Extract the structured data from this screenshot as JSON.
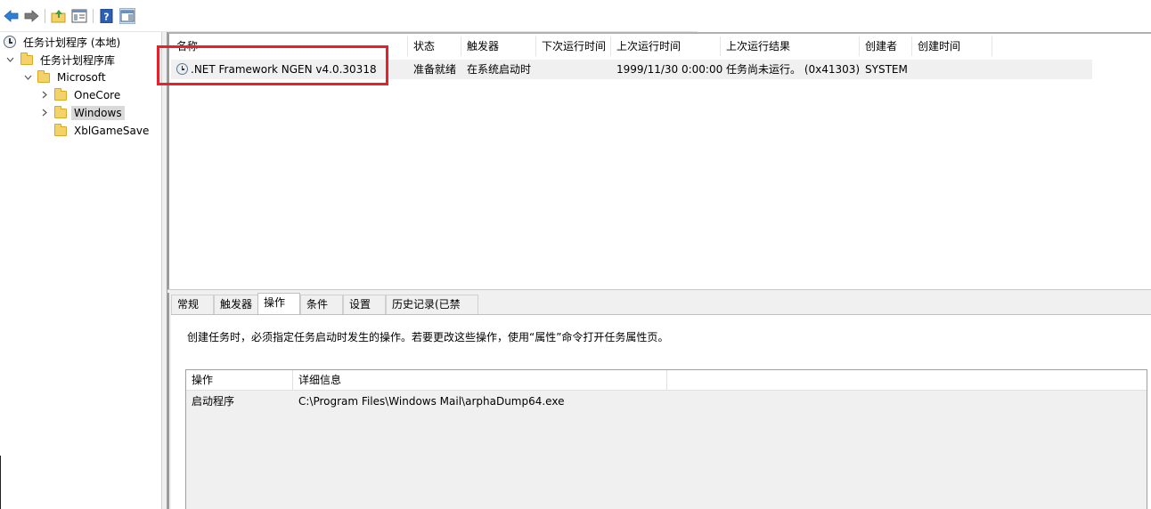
{
  "toolbar": {
    "buttons": [
      "back-icon",
      "forward-icon",
      "up-folder-icon",
      "show-hide-console-tree-icon",
      "help-icon",
      "show-hide-action-pane-icon"
    ]
  },
  "tree": {
    "root": "任务计划程序 (本地)",
    "library": "任务计划程序库",
    "microsoft": "Microsoft",
    "onecore": "OneCore",
    "windows": "Windows",
    "xbl": "XblGameSave"
  },
  "task_list": {
    "columns": [
      "名称",
      "状态",
      "触发器",
      "下次运行时间",
      "上次运行时间",
      "上次运行结果",
      "创建者",
      "创建时间"
    ],
    "rows": [
      {
        "name": ".NET Framework NGEN v4.0.30318",
        "status": "准备就绪",
        "trigger": "在系统启动时",
        "next_run": "",
        "last_run": "1999/11/30 0:00:00",
        "last_result": "任务尚未运行。 (0x41303)",
        "author": "SYSTEM",
        "created": ""
      }
    ]
  },
  "tabs": [
    "常规",
    "触发器",
    "操作",
    "条件",
    "设置",
    "历史记录(已禁用)"
  ],
  "active_tab": "操作",
  "actions_tab": {
    "description": "创建任务时，必须指定任务启动时发生的操作。若要更改这些操作，使用“属性”命令打开任务属性页。",
    "columns": [
      "操作",
      "详细信息"
    ],
    "rows": [
      {
        "action": "启动程序",
        "detail": "C:\\Program Files\\Windows Mail\\arphaDump64.exe"
      }
    ]
  },
  "colors": {
    "highlight_box": "#e8202a",
    "selection": "#d9d9d9"
  }
}
